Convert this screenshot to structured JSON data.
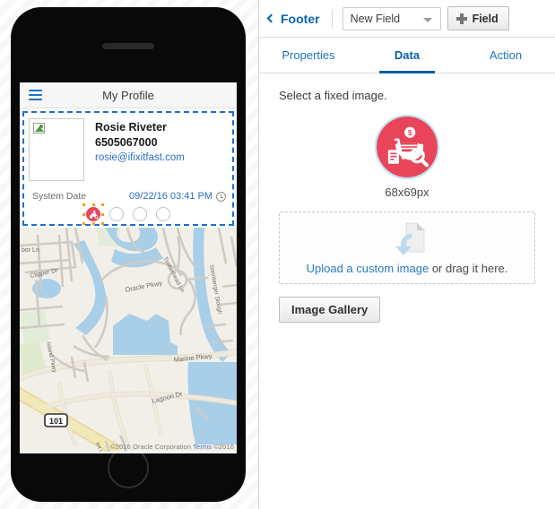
{
  "device_preview": {
    "app_bar": {
      "menu_icon": "hamburger-menu-icon",
      "title": "My Profile"
    },
    "profile_card": {
      "avatar_alt_icon": "broken-image-icon",
      "name": "Rosie Riveter",
      "phone": "6505067000",
      "email": "rosie@ifixitfast.com",
      "date_label": "System Date",
      "date_value": "09/22/16 03:41 PM",
      "clock_icon": "clock-icon",
      "footer_icons": [
        {
          "name": "selected-shopper-icon",
          "selected": true
        },
        {
          "name": "empty-circle-icon",
          "selected": false
        },
        {
          "name": "empty-circle-icon",
          "selected": false
        },
        {
          "name": "empty-circle-icon",
          "selected": false
        }
      ]
    },
    "map": {
      "attribution": "©2016 Oracle Corporation",
      "terms_label": "Terms",
      "attribution_tail": "©2016",
      "labels": [
        "bor Ln",
        "Clipper Dr",
        "Oracle Pkwy",
        "Timberhead Ln",
        "Steinberger Slough",
        "Island Pkwy",
        "Marine Pkwy",
        "Lagoon Dr",
        "101"
      ]
    }
  },
  "properties_panel": {
    "topbar": {
      "back_icon": "chevron-left-icon",
      "back_label": "Footer",
      "field_select_value": "New Field",
      "field_select_caret_icon": "caret-down-icon",
      "add_field_icon": "plus-icon",
      "add_field_label": "Field"
    },
    "tabs": [
      {
        "label": "Properties",
        "active": false
      },
      {
        "label": "Data",
        "active": true
      },
      {
        "label": "Action",
        "active": false
      }
    ],
    "data_tab": {
      "instruction": "Select a fixed image.",
      "fixed_image_icon": "shopper-cart-search-icon",
      "image_dimensions": "68x69px",
      "dropzone": {
        "icon": "upload-document-arrow-icon",
        "link_text": "Upload a custom image",
        "rest_text": " or drag it here."
      },
      "gallery_button_label": "Image Gallery"
    }
  },
  "colors": {
    "accent_blue": "#0a5fa8",
    "link_blue": "#2a7ac4",
    "selection_dash": "#1f6fd0",
    "icon_red": "#e8455b",
    "handle_orange": "#f59b1c"
  }
}
